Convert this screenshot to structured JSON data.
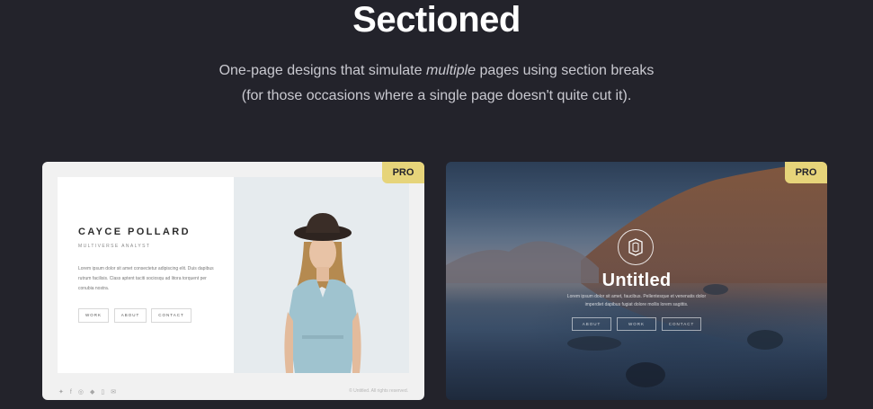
{
  "header": {
    "title": "Sectioned",
    "subtitle_prefix": "One-page designs that simulate ",
    "subtitle_em": "multiple",
    "subtitle_suffix": " pages using section breaks",
    "subtitle_line2": "(for those occasions where a single page doesn't quite cut it)."
  },
  "cards": [
    {
      "badge": "PRO",
      "preview": {
        "name": "CAYCE POLLARD",
        "role": "MULTIVERSE ANALYST",
        "bio": "Lorem ipsum dolor sit amet consectetur adipiscing elit. Duis dapibus rutrum facilisis. Class aptent taciti sociosqu ad litora torquent per conubia nostra.",
        "buttons": [
          "WORK",
          "ABOUT",
          "CONTACT"
        ],
        "social_icons": [
          "twitter-icon",
          "facebook-icon",
          "instagram-icon",
          "github-icon",
          "phone-icon",
          "email-icon"
        ],
        "copyright": "© Untitled. All rights reserved."
      }
    },
    {
      "badge": "PRO",
      "preview": {
        "title": "Untitled",
        "desc": "Lorem ipsum dolor sit amet, faucibus. Pellentesque et venenatis dolor imperdiet dapibus fugiat dolore mollis lorem sagittis.",
        "buttons": [
          "ABOUT",
          "WORK",
          "CONTACT"
        ]
      }
    }
  ],
  "colors": {
    "background": "#23232b",
    "badge": "#e6d47a",
    "card_left": "#f1f1f1"
  }
}
